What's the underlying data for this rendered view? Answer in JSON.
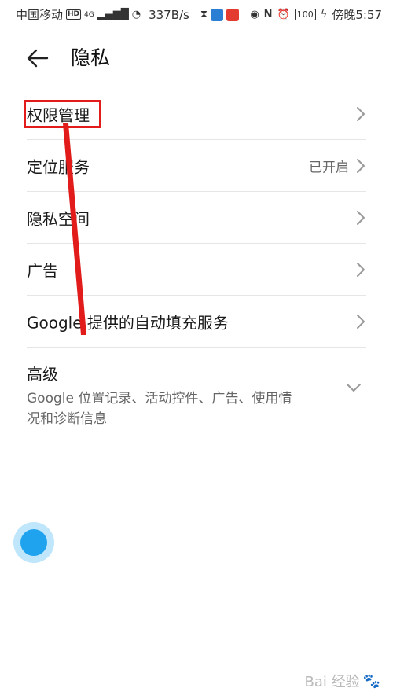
{
  "status_bar": {
    "carrier": "中国移动",
    "hd": "HD",
    "network": "4G",
    "speed": "337B/s",
    "battery": "100",
    "time": "傍晚5:57",
    "icons": [
      "hourglass-icon",
      "app-icon",
      "app-icon",
      "eye-icon",
      "nfc-icon",
      "alarm-icon"
    ]
  },
  "header": {
    "title": "隐私",
    "back_icon": "arrow-left-icon"
  },
  "items": [
    {
      "label": "权限管理",
      "value": ""
    },
    {
      "label": "定位服务",
      "value": "已开启"
    },
    {
      "label": "隐私空间",
      "value": ""
    },
    {
      "label": "广告",
      "value": ""
    },
    {
      "label": "Google 提供的自动填充服务",
      "value": ""
    }
  ],
  "advanced": {
    "label": "高级",
    "description": "Google 位置记录、活动控件、广告、使用情况和诊断信息"
  },
  "watermark": "Bai 经验",
  "colors": {
    "annotation": "#e21b1b",
    "float_ball": "#1fa3ee",
    "divider": "#e6e6e6"
  }
}
